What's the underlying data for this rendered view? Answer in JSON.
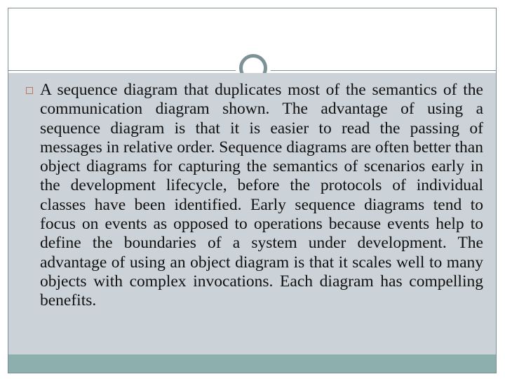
{
  "slide": {
    "title": "",
    "bullets": [
      {
        "marker": "square-outline",
        "text": "A sequence diagram that duplicates most of the semantics of the communication diagram shown. The advantage of using a sequence diagram is that it is easier to read the passing of messages in relative order. Sequence diagrams are often better than object diagrams for capturing the semantics of scenarios early in the development lifecycle, before the protocols of individual classes have been identified. Early sequence diagrams tend to focus on events as opposed to operations because events help to define the boundaries of a system under development. The advantage of using an object diagram is that it scales well to many objects with complex invocations. Each diagram has compelling benefits."
      }
    ],
    "decoration": {
      "ring_icon": "circle-ring-icon",
      "divider": "horizontal-rule"
    },
    "colors": {
      "body_background": "#ccd3d8",
      "accent_bar": "#8db0af",
      "frame_border": "#7c8f93",
      "divider": "#7d9096",
      "ring": "#7d9296",
      "bullet_marker": "#c2745c",
      "body_text": "#101010",
      "title_text": "#44565c",
      "slide_background": "#ffffff"
    }
  }
}
